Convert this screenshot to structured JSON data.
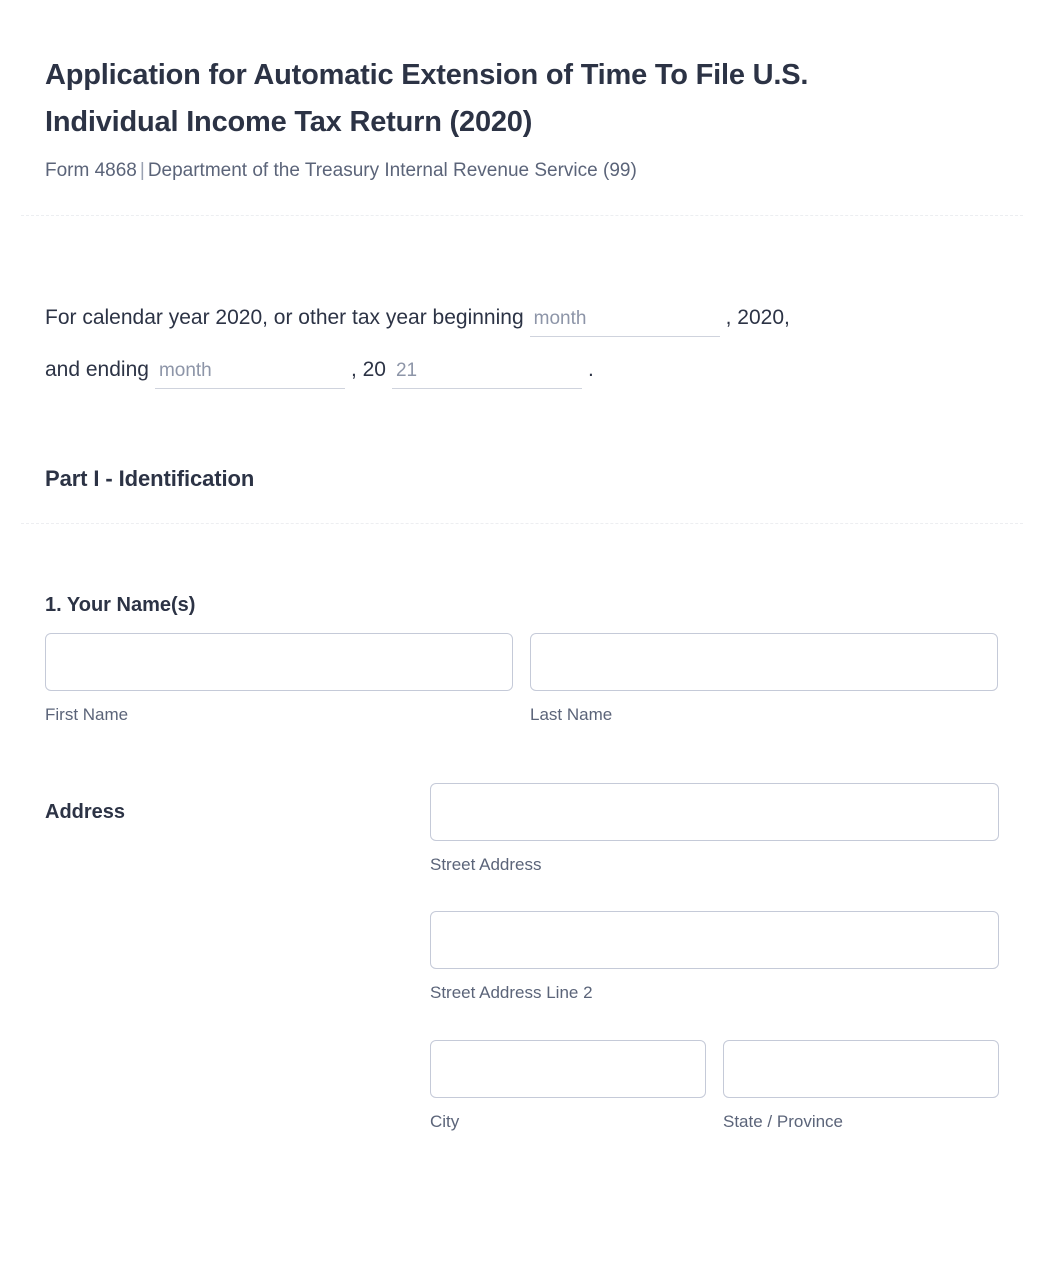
{
  "header": {
    "title": "Application for Automatic Extension of Time To File U.S. Individual Income Tax Return (2020)",
    "form_number": "Form 4868",
    "separator": "|",
    "agency": "Department of the Treasury Internal Revenue Service (99)"
  },
  "tax_year": {
    "line1_prefix": "For calendar year 2020, or other tax year beginning",
    "begin_month_placeholder": "month",
    "begin_month_value": "",
    "line1_suffix": ", 2020,",
    "line2_prefix": "and ending",
    "end_month_placeholder": "month",
    "end_month_value": "",
    "line2_mid": ", 20",
    "end_year_placeholder": "21",
    "end_year_value": "",
    "line2_suffix": "."
  },
  "part1": {
    "heading": "Part I - Identification"
  },
  "name_field": {
    "label": "1. Your Name(s)",
    "first_name": {
      "value": "",
      "placeholder": "",
      "sub_label": "First Name"
    },
    "last_name": {
      "value": "",
      "placeholder": "",
      "sub_label": "Last Name"
    }
  },
  "address_field": {
    "label": "Address",
    "street": {
      "value": "",
      "placeholder": "",
      "sub_label": "Street Address"
    },
    "street2": {
      "value": "",
      "placeholder": "",
      "sub_label": "Street Address Line 2"
    },
    "city": {
      "value": "",
      "placeholder": "",
      "sub_label": "City"
    },
    "state": {
      "value": "",
      "placeholder": "",
      "sub_label": "State / Province"
    }
  },
  "colors": {
    "heading_text": "#2c3345",
    "muted_text": "#5b6479",
    "placeholder_text": "#8d95a8",
    "input_border": "#c5cad8",
    "divider": "#eceef1",
    "background": "#ffffff"
  }
}
